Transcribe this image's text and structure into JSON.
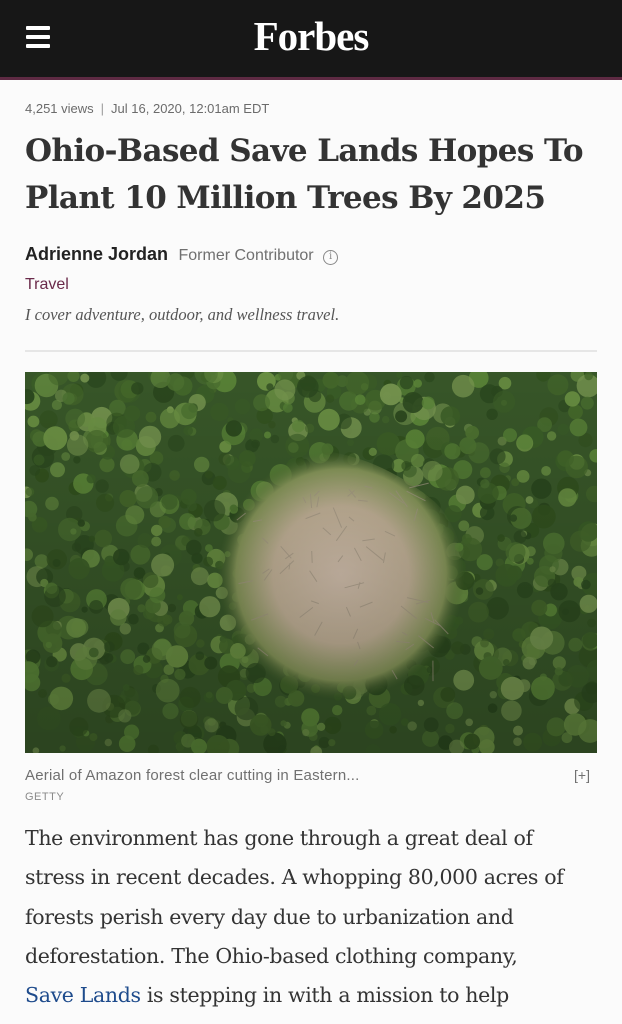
{
  "header": {
    "menu_icon": "hamburger-menu-icon",
    "logo": "Forbes",
    "colors": {
      "background": "#171717",
      "accent_rule": "#5e2a43"
    }
  },
  "article": {
    "views": "4,251 views",
    "separator": "|",
    "timestamp": "Jul 16, 2020, 12:01am EDT",
    "headline": "Ohio-Based Save Lands Hopes To Plant 10 Million Trees By 2025",
    "author": "Adrienne Jordan",
    "author_role": "Former Contributor",
    "info_icon": "info-circle-icon",
    "category": "Travel",
    "author_bio": "I cover adventure, outdoor, and wellness travel.",
    "image": {
      "description_icon": "aerial-forest-clearing-photo",
      "caption": "Aerial of Amazon forest clear cutting in Eastern...",
      "expand_label": "[+]",
      "credit": "GETTY"
    },
    "body": {
      "line1": "The environment has gone through a great deal of",
      "line2": "stress in recent decades. A whopping 80,000 acres of",
      "line3": "forests perish every day due to urbanization and",
      "line4": "deforestation. The Ohio-based clothing company,",
      "link_text": "Save Lands",
      "line5_rest": " is stepping in with a mission to help"
    },
    "colors": {
      "category": "#6a2a4a",
      "link": "#1e4b8c"
    }
  }
}
